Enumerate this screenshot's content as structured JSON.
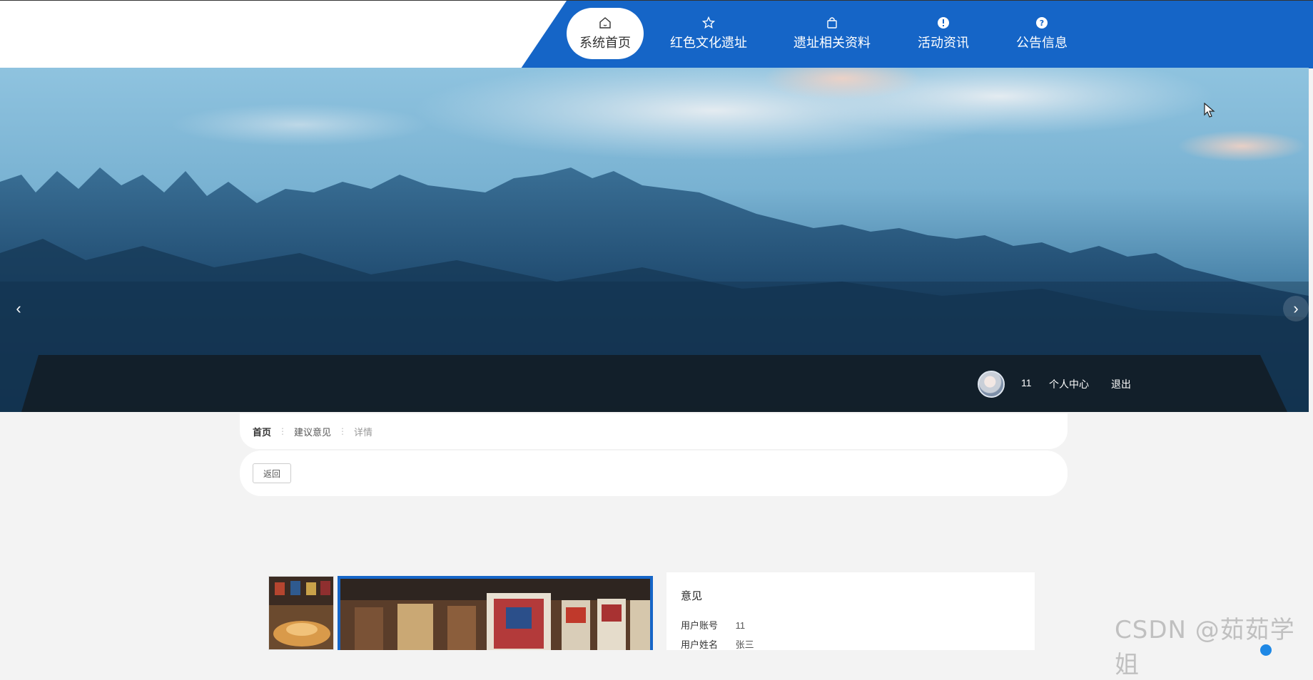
{
  "nav": {
    "items": [
      {
        "label": "系统首页",
        "icon": "home-icon",
        "active": true
      },
      {
        "label": "红色文化遗址",
        "icon": "star-icon",
        "active": false
      },
      {
        "label": "遗址相关资料",
        "icon": "bag-icon",
        "active": false
      },
      {
        "label": "活动资讯",
        "icon": "info-icon",
        "active": false
      },
      {
        "label": "公告信息",
        "icon": "help-icon",
        "active": false
      }
    ]
  },
  "hero": {
    "prev_arrow": "‹",
    "next_arrow": "›"
  },
  "user": {
    "name": "11",
    "center_link": "个人中心",
    "logout_link": "退出"
  },
  "breadcrumb": {
    "home": "首页",
    "section": "建议意见",
    "current": "详情",
    "separator": "⋮"
  },
  "back_button": "返回",
  "detail": {
    "title": "意见",
    "rows": [
      {
        "label": "用户账号",
        "value": "11"
      },
      {
        "label": "用户姓名",
        "value": "张三"
      }
    ]
  },
  "watermark": "CSDN @茹茹学姐",
  "colors": {
    "primary": "#1565c7",
    "band": "#121c24"
  }
}
